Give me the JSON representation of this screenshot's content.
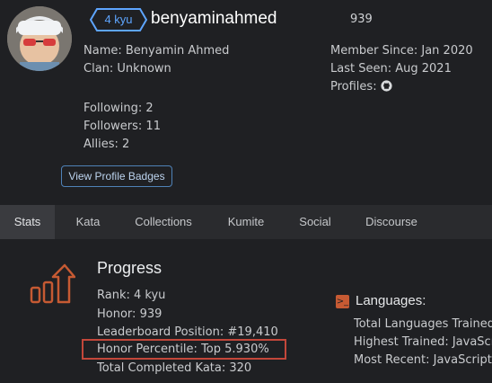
{
  "profile": {
    "rank_badge": "4 kyu",
    "username": "benyaminahmed",
    "honor": "939",
    "name_label": "Name:",
    "name_value": "Benyamin Ahmed",
    "clan_label": "Clan:",
    "clan_value": "Unknown",
    "member_since_label": "Member Since:",
    "member_since_value": "Jan 2020",
    "last_seen_label": "Last Seen:",
    "last_seen_value": "Aug 2021",
    "profiles_label": "Profiles:",
    "profiles_icon": "github-icon",
    "following_label": "Following:",
    "following_value": "2",
    "followers_label": "Followers:",
    "followers_value": "11",
    "allies_label": "Allies:",
    "allies_value": "2",
    "badges_button": "View Profile Badges"
  },
  "tabs": [
    {
      "label": "Stats",
      "active": true
    },
    {
      "label": "Kata"
    },
    {
      "label": "Collections"
    },
    {
      "label": "Kumite"
    },
    {
      "label": "Social"
    },
    {
      "label": "Discourse"
    }
  ],
  "progress": {
    "title": "Progress",
    "rank_label": "Rank:",
    "rank_value": "4 kyu",
    "honor_label": "Honor:",
    "honor_value": "939",
    "leaderboard_label": "Leaderboard Position:",
    "leaderboard_value": "#19,410",
    "percentile_label": "Honor Percentile:",
    "percentile_value": "Top 5.930%",
    "completed_label": "Total Completed Kata:",
    "completed_value": "320"
  },
  "languages": {
    "title": "Languages:",
    "total_label": "Total Languages Trained:",
    "highest_label": "Highest Trained:",
    "highest_value": "JavaScript",
    "recent_label": "Most Recent:",
    "recent_value": "JavaScript"
  },
  "colors": {
    "background": "#1f2023",
    "accent_blue": "#5ea5ff",
    "highlight_red": "#c3473a",
    "progress_icon": "#c65a33"
  }
}
